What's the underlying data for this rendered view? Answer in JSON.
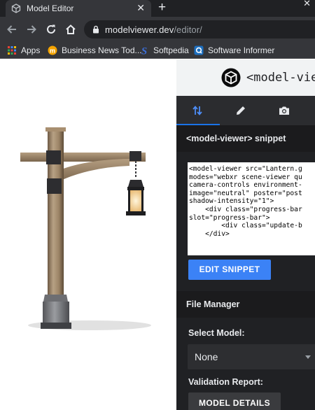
{
  "browser": {
    "tab_title": "Model Editor",
    "tab_close": "✕",
    "new_tab": "+",
    "window_close": "✕",
    "url_host": "modelviewer.dev",
    "url_path": "/editor/",
    "bookmarks": [
      {
        "label": "Apps",
        "icon": "apps-grid-icon"
      },
      {
        "label": "Business News Tod...",
        "icon": "business-news-icon"
      },
      {
        "label": "Softpedia",
        "icon": "softpedia-icon"
      },
      {
        "label": "Software Informer",
        "icon": "software-informer-icon"
      }
    ]
  },
  "editor": {
    "header_title": "<model-viewer",
    "tabs": [
      {
        "name": "arrange",
        "icon": "swap-vertical-icon",
        "active": true
      },
      {
        "name": "edit",
        "icon": "pencil-icon",
        "active": false
      },
      {
        "name": "camera",
        "icon": "camera-icon",
        "active": false
      }
    ],
    "snippet": {
      "heading": "<model-viewer> snippet",
      "code_lines": [
        "<model-viewer src=\"Lantern.g",
        "modes=\"webxr scene-viewer qu",
        "camera-controls environment-",
        "image=\"neutral\" poster=\"post",
        "shadow-intensity=\"1\">",
        "",
        "    <div class=\"progress-bar",
        "slot=\"progress-bar\">",
        "        <div class=\"update-b",
        "    </div>"
      ],
      "edit_button": "EDIT SNIPPET"
    },
    "file_manager": {
      "heading": "File Manager",
      "select_label": "Select Model:",
      "select_value": "None",
      "validation_label": "Validation Report:",
      "details_button": "MODEL DETAILS"
    }
  },
  "colors": {
    "accent_blue": "#3b82f6",
    "panel_bg": "#202124",
    "chrome_bg": "#35363a"
  }
}
